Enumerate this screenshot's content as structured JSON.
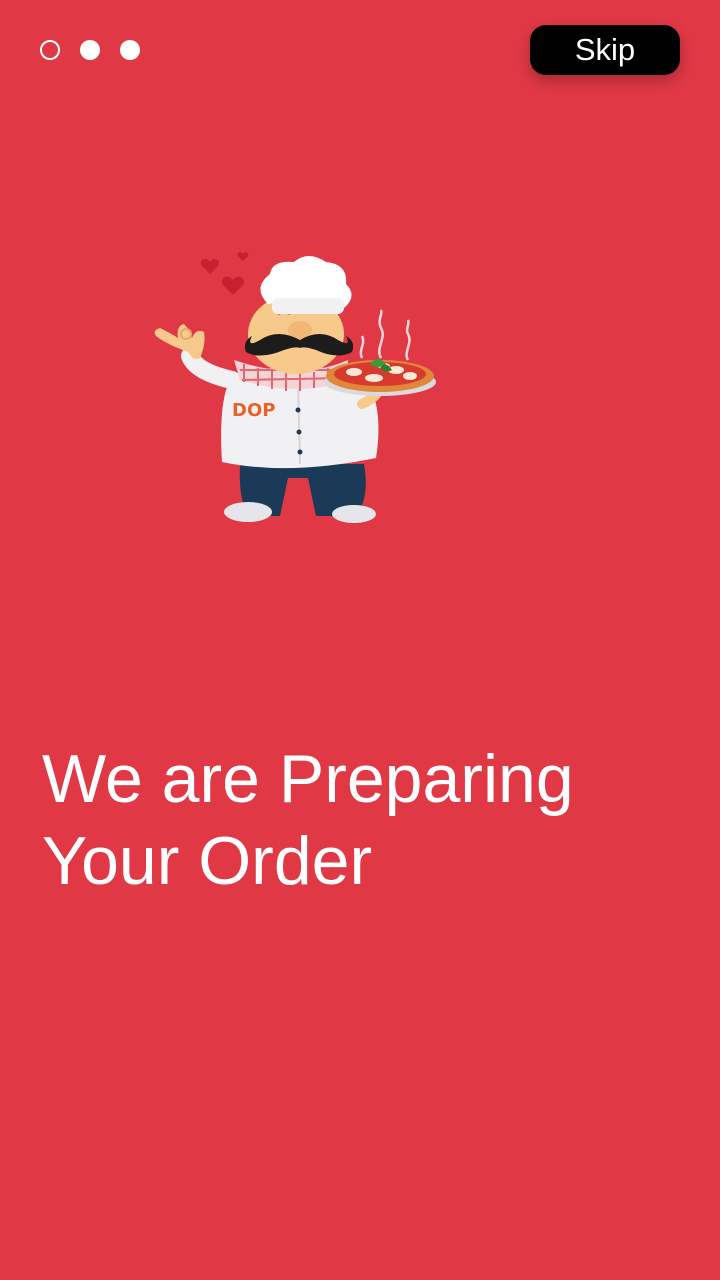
{
  "pager": {
    "pages": 3,
    "current": 1
  },
  "skip_button": {
    "label": "Skip"
  },
  "illustration": {
    "icon": "chef-with-pizza-illustration",
    "badge_text": "DOP"
  },
  "headline": {
    "line1": "We are Preparing",
    "line2": "Your Order"
  },
  "colors": {
    "background": "#e13846",
    "skip_background": "#000000",
    "text": "#ffffff"
  }
}
